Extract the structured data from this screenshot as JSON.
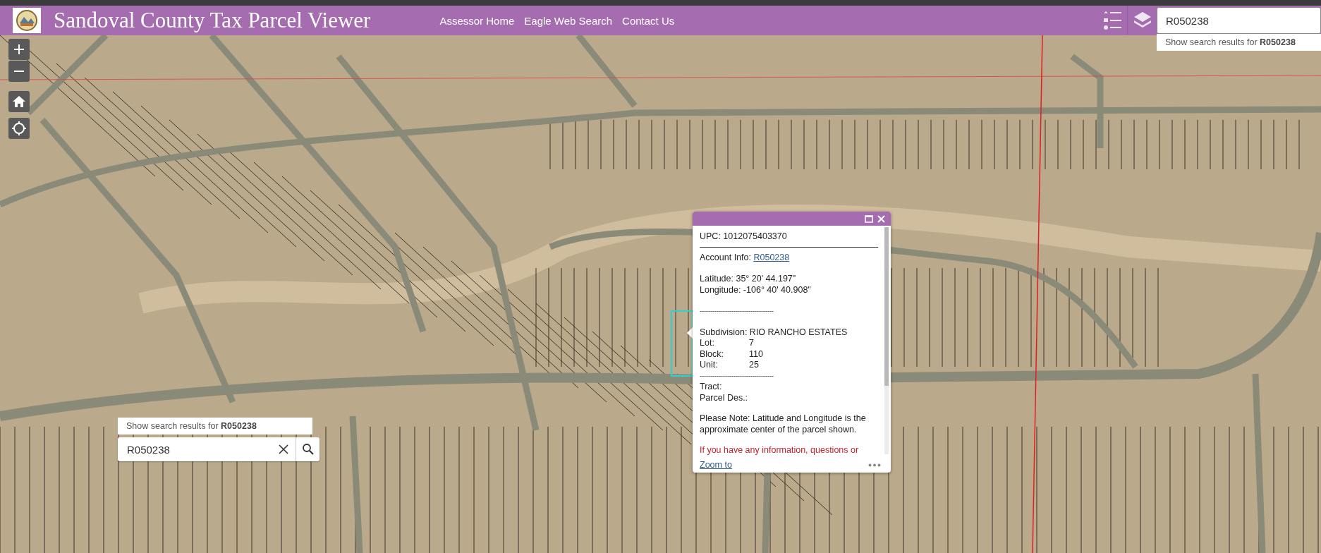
{
  "header": {
    "title": "Sandoval County Tax Parcel Viewer",
    "nav_links": [
      "Assessor Home",
      "Eagle Web Search",
      "Contact Us"
    ]
  },
  "top_search": {
    "value": "R050238",
    "suggestion": "Show search results for **R050238**"
  },
  "map_search": {
    "value": "R050238",
    "suggestion": "Show search results for **R050238**"
  },
  "popup": {
    "upc": "UPC: 1012075403370",
    "account_label": "Account Info:",
    "account_link": "R050238",
    "latitude": "Latitude: 35° 20' 44.197\"",
    "longitude": "Longitude: -106° 40' 40.908\"",
    "separator_1": "-----------------------------------",
    "subdivision": "Subdivision: RIO RANCHO ESTATES",
    "fields": [
      {
        "label": "Lot:",
        "value": "7"
      },
      {
        "label": "Block:",
        "value": "110"
      },
      {
        "label": "Unit:",
        "value": "25"
      }
    ],
    "separator_2": "-----------------------------------",
    "tract": "Tract:",
    "parcel_des": "Parcel Des.:",
    "note": "Please Note: Latitude and Longitude is the approximate center of the parcel shown.",
    "warning": "If you have any information, questions or",
    "zoom_link": "Zoom to"
  }
}
